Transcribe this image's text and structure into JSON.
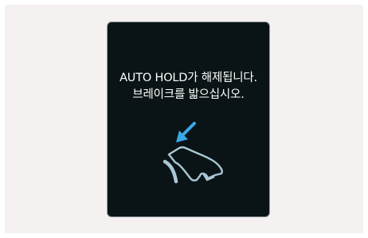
{
  "display": {
    "message_line1": "AUTO HOLD가 해제됩니다.",
    "message_line2": "브레이크를 밟으십시오.",
    "icon": "brake-pedal-foot-icon",
    "colors": {
      "background": "#0a1416",
      "text": "#ffffff",
      "icon_outline": "#a9c7d4",
      "arrow": "#3aa8e6"
    }
  }
}
